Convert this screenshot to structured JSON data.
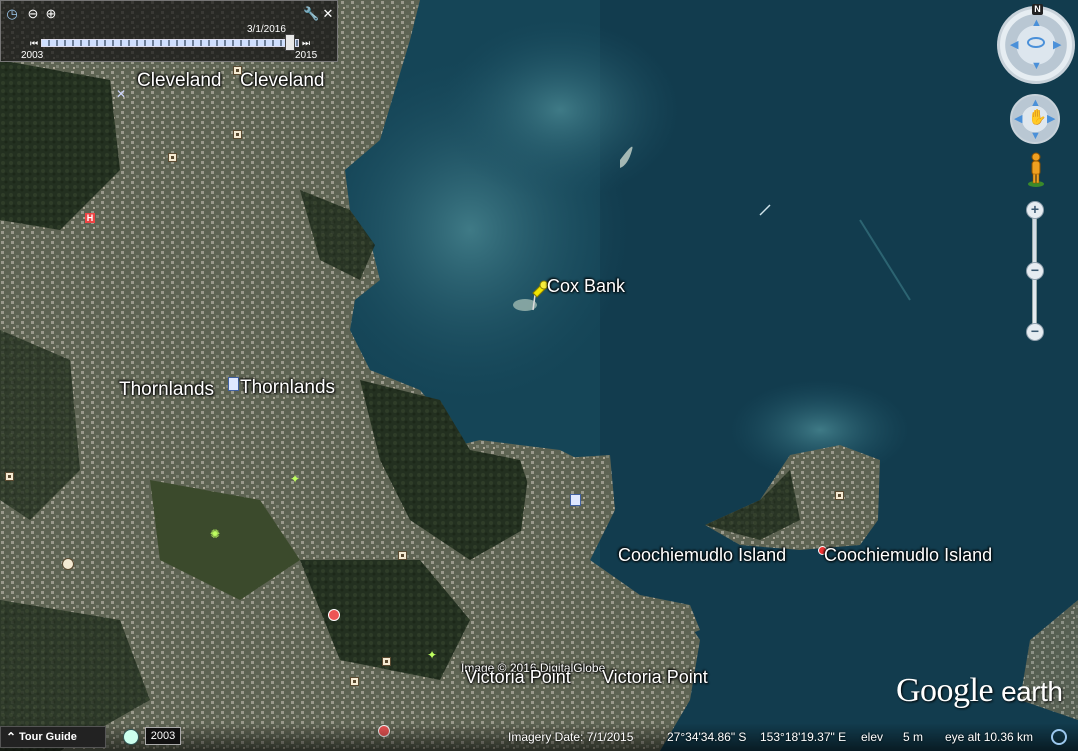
{
  "time_slider": {
    "date": "3/1/2016",
    "start_year": "2003",
    "end_year": "2015"
  },
  "places": {
    "cleveland_1": "Cleveland",
    "cleveland_2": "Cleveland",
    "thornlands_1": "Thornlands",
    "thornlands_2": "Thornlands",
    "cox_bank": "Cox Bank",
    "coochiemudlo_1": "Coochiemudlo Island",
    "coochiemudlo_2": "Coochiemudlo Island",
    "victoria_1": "Victoria Point",
    "victoria_2": "Victoria Point"
  },
  "copyright": "Image © 2016 DigitalGlobe",
  "status": {
    "tour_guide": "Tour Guide",
    "year": "2003",
    "imagery_date": "Imagery Date: 7/1/2015",
    "latitude": "27°34'34.86\" S",
    "longitude": "153°18'19.37\" E",
    "elev_label": "elev",
    "elev_value": "5 m",
    "eye_alt": "eye alt  10.36 km"
  },
  "compass_north": "N",
  "logo": {
    "google": "Google",
    "earth": "earth"
  },
  "colors": {
    "water": "#15485a",
    "land": "#3d4a2e",
    "pin": "#f2e600"
  }
}
